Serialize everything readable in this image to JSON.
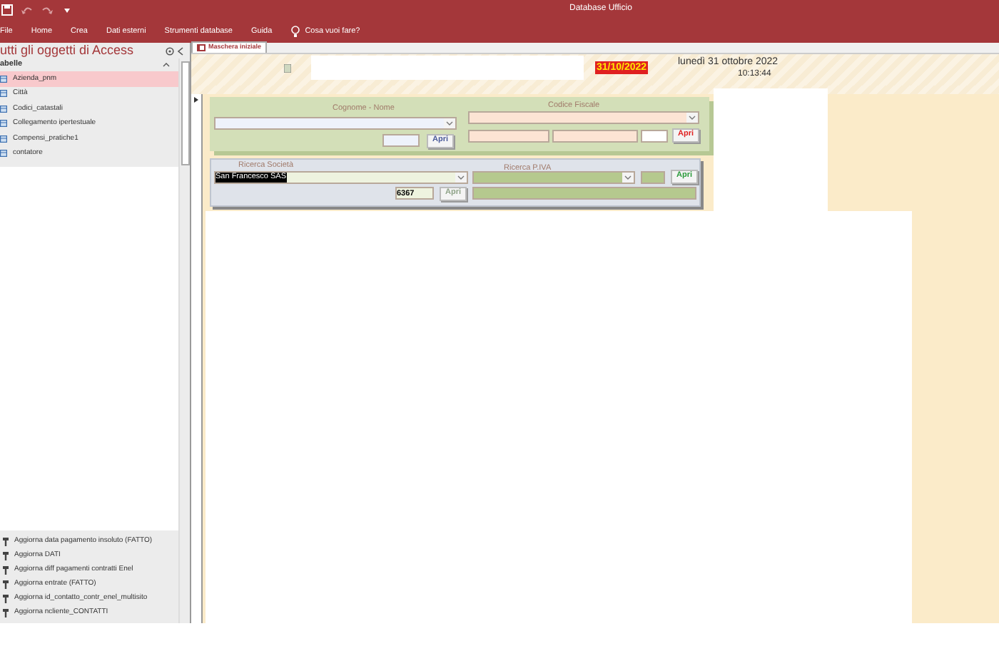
{
  "window": {
    "title": "Database Ufficio"
  },
  "menu": [
    {
      "label": "File"
    },
    {
      "label": "Home"
    },
    {
      "label": "Crea"
    },
    {
      "label": "Dati esterni"
    },
    {
      "label": "Strumenti database"
    },
    {
      "label": "Guida"
    }
  ],
  "tell_me": "Cosa vuoi fare?",
  "nav": {
    "title": "utti gli oggetti di Access",
    "group": "abelle",
    "tables": [
      {
        "label": "Azienda_pnm",
        "selected": true
      },
      {
        "label": "Città",
        "selected": false
      },
      {
        "label": "Codici_catastali",
        "selected": false
      },
      {
        "label": "Collegamento ipertestuale",
        "selected": false
      },
      {
        "label": "Compensi_pratiche1",
        "selected": false
      },
      {
        "label": "contatore",
        "selected": false
      }
    ],
    "macros": [
      {
        "label": "Aggiorna data pagamento insoluto (FATTO)"
      },
      {
        "label": "Aggiorna DATI"
      },
      {
        "label": "Aggiorna diff pagamenti contratti Enel"
      },
      {
        "label": "Aggiorna entrate (FATTO)"
      },
      {
        "label": "Aggiorna id_contatto_contr_enel_multisito"
      },
      {
        "label": "Aggiorna ncliente_CONTATTI"
      }
    ]
  },
  "document_tab": "Maschera iniziale",
  "header": {
    "date_badge": "31/10/2022",
    "long_date": "lunedì 31 ottobre 2022",
    "time": "10:13:44"
  },
  "form": {
    "name_search": {
      "label": "Cognome - Nome",
      "button": "Apri"
    },
    "fiscal_code": {
      "label": "Codice Fiscale",
      "button": "Apri"
    },
    "company": {
      "label": "Ricerca Società",
      "value": "San Francesco SAS",
      "code": "6367",
      "button": "Apri",
      "disabled": true
    },
    "vat": {
      "label": "Ricerca P.IVA",
      "button": "Apri",
      "disabled": false
    }
  }
}
